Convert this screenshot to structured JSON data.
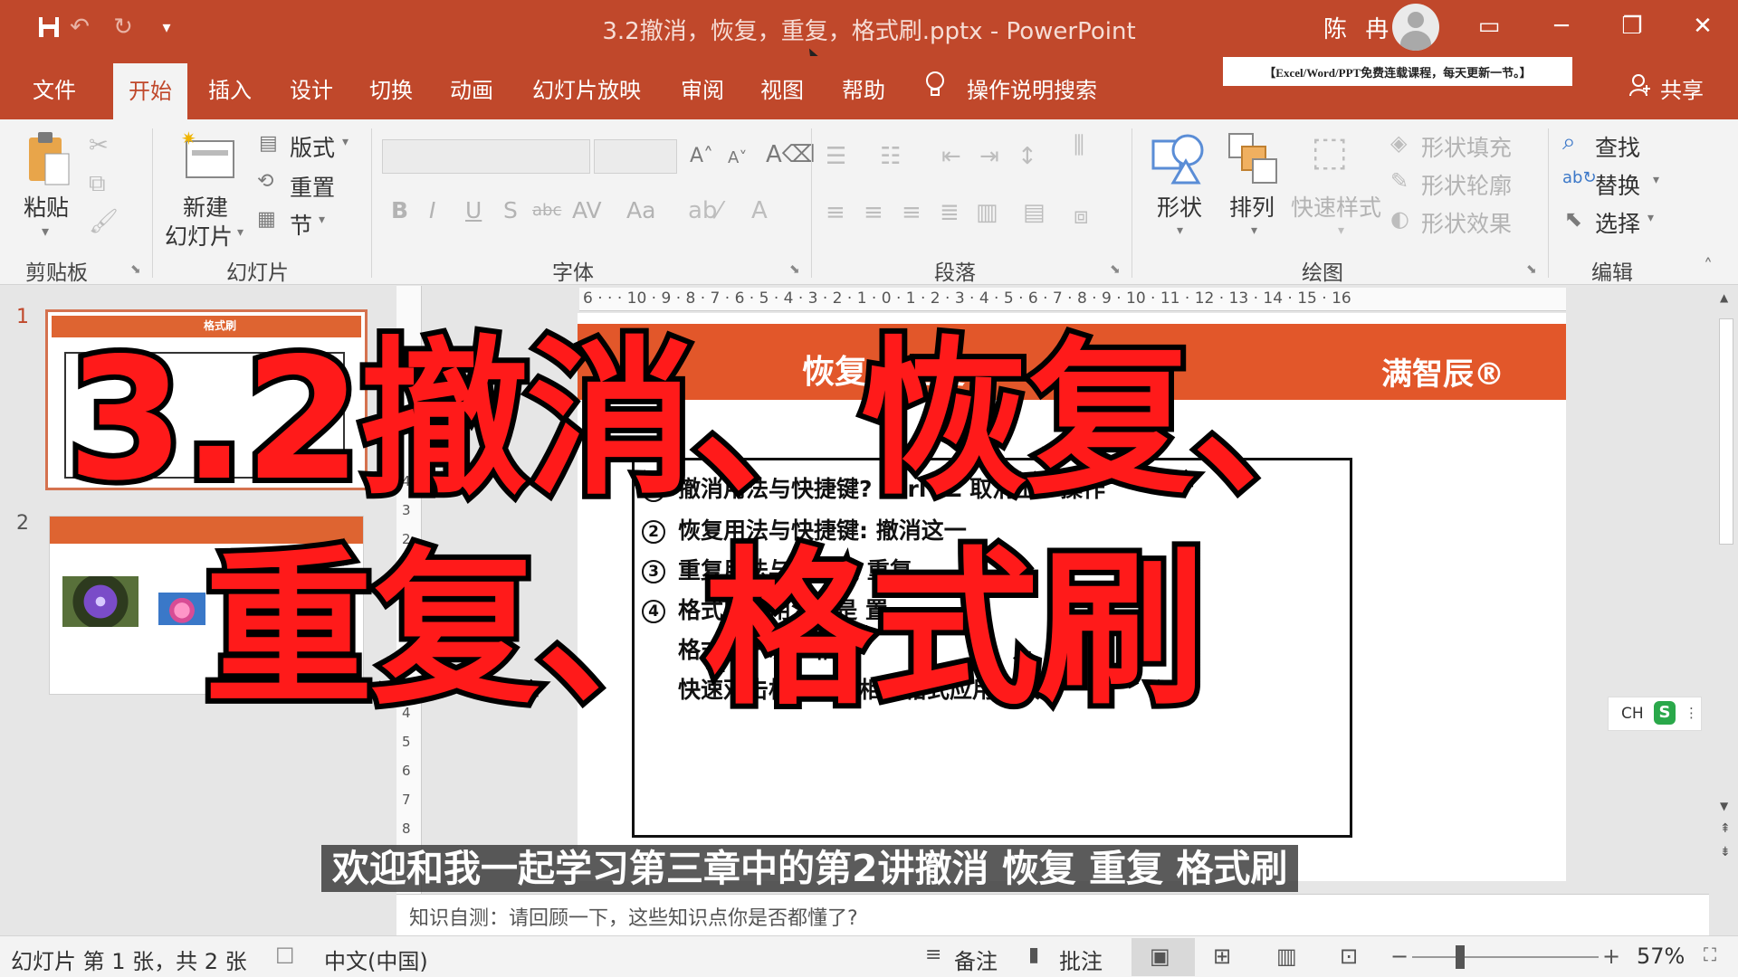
{
  "window": {
    "title": "3.2撤消，恢复，重复，格式刷.pptx  -  PowerPoint",
    "user_name": "陈 冉",
    "quick_access": {
      "save_icon": "save-icon",
      "undo_icon": "undo-icon",
      "redo_icon": "redo-icon"
    },
    "controls": {
      "ribbon_display": "▭",
      "minimize": "─",
      "restore": "❐",
      "close": "✕"
    },
    "accent_color": "#c0482b"
  },
  "tabs": [
    {
      "label": "文件"
    },
    {
      "label": "开始",
      "active": true
    },
    {
      "label": "插入"
    },
    {
      "label": "设计"
    },
    {
      "label": "切换"
    },
    {
      "label": "动画"
    },
    {
      "label": "幻灯片放映"
    },
    {
      "label": "审阅"
    },
    {
      "label": "视图"
    },
    {
      "label": "帮助"
    }
  ],
  "tell_me": "操作说明搜索",
  "share": "共享",
  "promo_banner": "【Excel/Word/PPT免费连载课程，每天更新一节。】",
  "ribbon": {
    "clipboard": {
      "paste": "粘贴",
      "group": "剪贴板"
    },
    "slides": {
      "new_slide_1": "新建",
      "new_slide_2": "幻灯片",
      "layout": "版式",
      "reset": "重置",
      "section": "节",
      "group": "幻灯片"
    },
    "font": {
      "group": "字体",
      "bold": "B",
      "italic": "I",
      "underline": "U",
      "shadow": "S",
      "strike": "abc",
      "spacing": "AV",
      "case": "Aa"
    },
    "paragraph": {
      "group": "段落"
    },
    "drawing": {
      "shapes": "形状",
      "arrange": "排列",
      "quick_styles": "快速样式",
      "fill": "形状填充",
      "outline": "形状轮廓",
      "effects": "形状效果",
      "group": "绘图"
    },
    "editing": {
      "find": "查找",
      "replace": "替换",
      "select": "选择",
      "group": "编辑"
    }
  },
  "slides": [
    {
      "number": "1",
      "title_snippet": "格式刷"
    },
    {
      "number": "2"
    }
  ],
  "ruler": {
    "horizontal": "6 · · · 10 · 9 · 8 · 7 · 6 · 5 · 4 · 3 · 2 · 1 · 0 · 1 · 2 · 3 · 4 · 5 · 6 · 7 · 8 · 9 · 10 · 11 · 12 · 13 · 14 · 15 · 16",
    "vertical": [
      "4",
      "3",
      "2",
      "1",
      "0",
      "1",
      "2",
      "3",
      "4",
      "5",
      "6",
      "7",
      "8"
    ]
  },
  "slide": {
    "title": "恢复，重复",
    "brand": "满智辰®",
    "lines": [
      {
        "num": "1",
        "text": "撤消用法与快捷键?  Ctrl+Z 取消上一操作"
      },
      {
        "num": "2",
        "text": "恢复用法与快捷键:  撤消这一"
      },
      {
        "num": "3",
        "text": "重复用法与快捷键  重复"
      },
      {
        "num": "4",
        "text": "格式刷的用法?  是  置"
      },
      {
        "num": "",
        "text": "格式刷一次，相"
      },
      {
        "num": "",
        "text": "快速双击格式刷，相同格式应用多次"
      }
    ]
  },
  "ime": "CH",
  "notes": "知识自测：请回顾一下，这些知识点你是否都懂了?",
  "overlay": {
    "line1": "3.2撤消、恢复、",
    "line2": "重复、格式刷",
    "subtitle": "欢迎和我一起学习第三章中的第2讲撤消 恢复 重复 格式刷"
  },
  "status": {
    "slide_info": "幻灯片 第 1 张，共 2 张",
    "language": "中文(中国)",
    "notes": "备注",
    "comments": "批注",
    "zoom": "57%",
    "zoom_minus": "−",
    "zoom_plus": "+"
  }
}
